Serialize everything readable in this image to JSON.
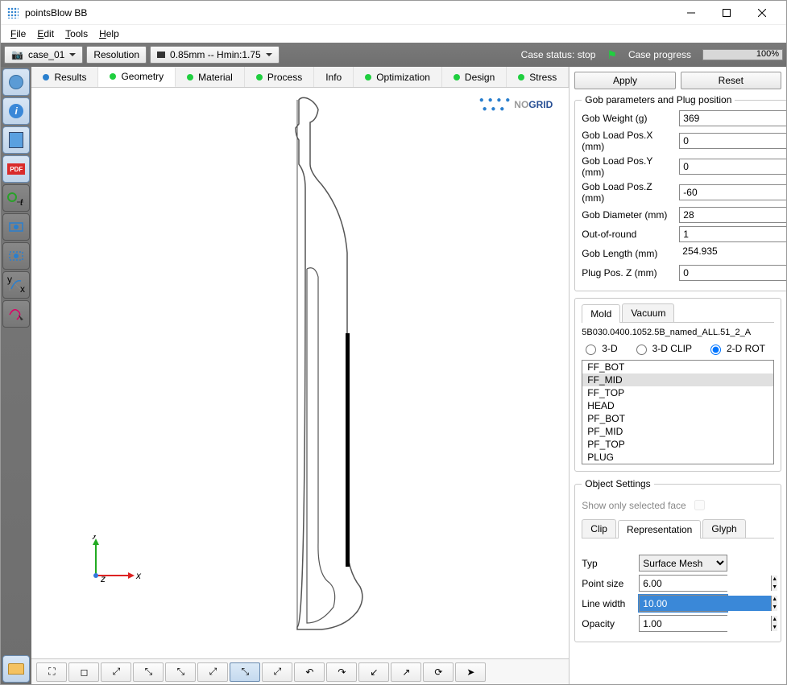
{
  "window": {
    "title": "pointsBlow BB"
  },
  "menu": {
    "file": "File",
    "edit": "Edit",
    "tools": "Tools",
    "help": "Help"
  },
  "toolbar": {
    "case": "case_01",
    "resolution_label": "Resolution",
    "resolution_value": "0.85mm -- Hmin:1.75",
    "case_status_label": "Case status:",
    "case_status_value": "stop",
    "case_progress_label": "Case progress",
    "case_progress_value": "100%"
  },
  "tabs": {
    "results": "Results",
    "geometry": "Geometry",
    "material": "Material",
    "process": "Process",
    "info": "Info",
    "optimization": "Optimization",
    "design": "Design",
    "stress": "Stress"
  },
  "logo": {
    "no": "NO",
    "grid": "GRID"
  },
  "axis": {
    "x": "x",
    "y": "y",
    "z": "z"
  },
  "buttons": {
    "apply": "Apply",
    "reset": "Reset"
  },
  "gob": {
    "legend": "Gob parameters and Plug position",
    "weight_label": "Gob Weight (g)",
    "weight": "369",
    "posx_label": "Gob Load Pos.X (mm)",
    "posx": "0",
    "posy_label": "Gob Load Pos.Y (mm)",
    "posy": "0",
    "posz_label": "Gob Load Pos.Z (mm)",
    "posz": "-60",
    "diam_label": "Gob Diameter (mm)",
    "diam": "28",
    "oor_label": "Out-of-round",
    "oor": "1",
    "len_label": "Gob Length (mm)",
    "len": "254.935",
    "plug_label": "Plug Pos. Z (mm)",
    "plug": "0"
  },
  "mold": {
    "tab_mold": "Mold",
    "tab_vacuum": "Vacuum",
    "filename": "5B030.0400.1052.5B_named_ALL.51_2_A",
    "r3d": "3-D",
    "r3dclip": "3-D CLIP",
    "r2drot": "2-D ROT",
    "items": [
      "FF_BOT",
      "FF_MID",
      "FF_TOP",
      "HEAD",
      "PF_BOT",
      "PF_MID",
      "PF_TOP",
      "PLUG"
    ],
    "selected_index": 1
  },
  "obj": {
    "legend": "Object Settings",
    "show_only": "Show only selected face",
    "tab_clip": "Clip",
    "tab_rep": "Representation",
    "tab_glyph": "Glyph",
    "typ_label": "Typ",
    "typ_value": "Surface Mesh",
    "point_label": "Point size",
    "point": "6.00",
    "line_label": "Line width",
    "line": "10.00",
    "opacity_label": "Opacity",
    "opacity": "1.00"
  },
  "sidebar_pdf": "PDF"
}
